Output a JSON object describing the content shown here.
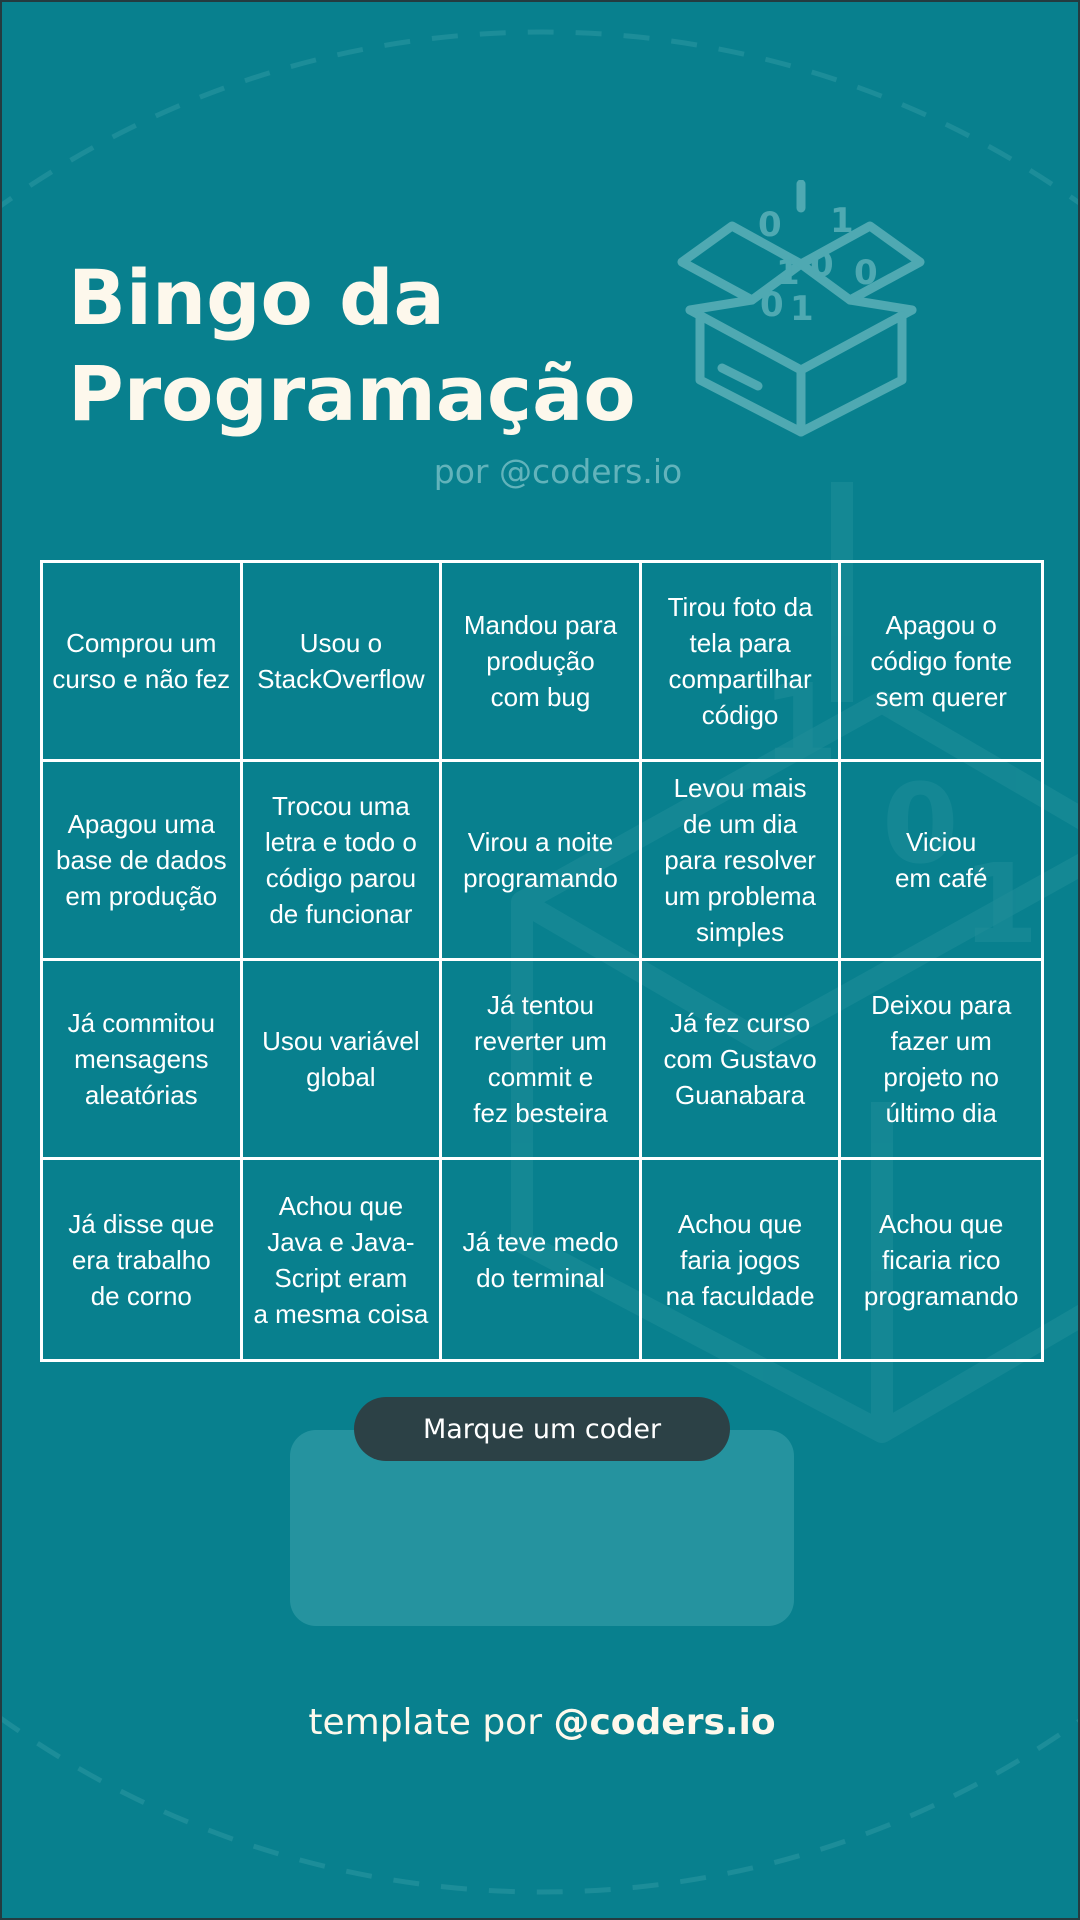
{
  "header": {
    "title_line1": "Bingo da",
    "title_line2": "Programação",
    "byline": "por @coders.io"
  },
  "icons": {
    "hero": "open-box-with-binary-icon"
  },
  "bingo": {
    "cells": [
      "Comprou um\ncurso e não fez",
      "Usou o\nStackOverflow",
      "Mandou para\nprodução\ncom bug",
      "Tirou foto da\ntela para\ncompartilhar\ncódigo",
      "Apagou o\ncódigo fonte\nsem querer",
      "Apagou uma\nbase de dados\nem produção",
      "Trocou uma\nletra e todo o\ncódigo parou\nde funcionar",
      "Virou a noite\nprogramando",
      "Levou mais\nde um dia\npara resolver\num problema\nsimples",
      "Viciou\nem café",
      "Já commitou\nmensagens\naleatórias",
      "Usou variável\nglobal",
      "Já tentou\nreverter um\ncommit e\nfez besteira",
      "Já fez curso\ncom Gustavo\nGuanabara",
      "Deixou para\nfazer um\nprojeto no\núltimo dia",
      "Já disse que\nera trabalho\nde corno",
      "Achou que\nJava e Java-\nScript eram\na mesma coisa",
      "Já teve medo\ndo terminal",
      "Achou que\nfaria jogos\nna faculdade",
      "Achou que\nficaria rico\nprogramando"
    ]
  },
  "tag": {
    "button_label": "Marque um coder"
  },
  "footer": {
    "prefix": "template por ",
    "handle": "@coders.io"
  },
  "colors": {
    "background": "#08808e",
    "title": "#fdf8ec",
    "byline": "#62b3bb",
    "button": "#2c4146"
  }
}
